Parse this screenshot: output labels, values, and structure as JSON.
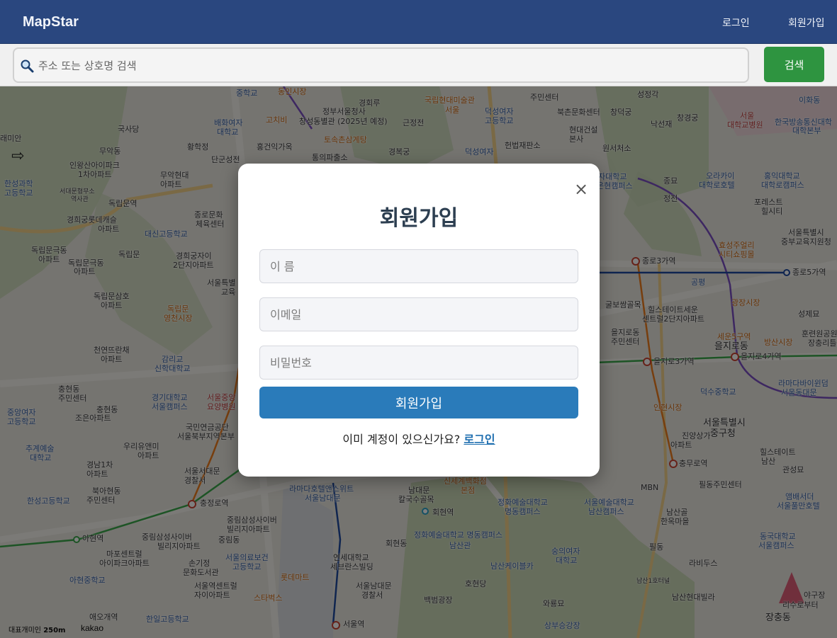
{
  "header": {
    "brand": "MapStar",
    "login_link": "로그인",
    "signup_link": "회원가입"
  },
  "search": {
    "placeholder": "주소 또는 상호명 검색",
    "button_label": "검색",
    "icon": "search-icon"
  },
  "map": {
    "provider": "kakao",
    "scale_label": "250m",
    "scale_prefix": "대표개미인",
    "labels": [
      {
        "text": "중학교",
        "cls": "blue"
      },
      {
        "text": "동인시장",
        "cls": "orange"
      },
      {
        "text": "경회루",
        "cls": ""
      },
      {
        "text": "국립현대미술관",
        "cls": "orange"
      },
      {
        "text": "서울",
        "cls": "orange"
      },
      {
        "text": "주민센터",
        "cls": ""
      },
      {
        "text": "성정각",
        "cls": ""
      },
      {
        "text": "이화동",
        "cls": "blue"
      },
      {
        "text": "국사당",
        "cls": ""
      },
      {
        "text": "배화여자",
        "cls": "blue"
      },
      {
        "text": "대학교",
        "cls": "blue"
      },
      {
        "text": "고치비",
        "cls": "orange"
      },
      {
        "text": "정부서울청사",
        "cls": ""
      },
      {
        "text": "창성동별관 (2025년 예정)",
        "cls": ""
      },
      {
        "text": "근정전",
        "cls": ""
      },
      {
        "text": "덕성여자",
        "cls": "blue"
      },
      {
        "text": "고등학교",
        "cls": "blue"
      },
      {
        "text": "북촌문화센터",
        "cls": ""
      },
      {
        "text": "창덕궁",
        "cls": ""
      },
      {
        "text": "창경궁",
        "cls": ""
      },
      {
        "text": "서울",
        "cls": "red"
      },
      {
        "text": "대학교병원",
        "cls": "red"
      },
      {
        "text": "한국방송통신대학",
        "cls": "blue"
      },
      {
        "text": "대학본부",
        "cls": "blue"
      },
      {
        "text": "낙선재",
        "cls": ""
      },
      {
        "text": "현대건설",
        "cls": ""
      },
      {
        "text": "본사",
        "cls": ""
      },
      {
        "text": "래미안",
        "cls": ""
      },
      {
        "text": "무악동",
        "cls": ""
      },
      {
        "text": "황학정",
        "cls": ""
      },
      {
        "text": "홍건익가옥",
        "cls": ""
      },
      {
        "text": "토속촌삼계탕",
        "cls": "orange"
      },
      {
        "text": "경복궁",
        "cls": ""
      },
      {
        "text": "헌법재판소",
        "cls": ""
      },
      {
        "text": "원서처소",
        "cls": ""
      },
      {
        "text": "통의파출소",
        "cls": ""
      },
      {
        "text": "덕성여자",
        "cls": "blue"
      },
      {
        "text": "인왕산아이파크",
        "cls": ""
      },
      {
        "text": "1차아파트",
        "cls": ""
      },
      {
        "text": "한성과학",
        "cls": "blue"
      },
      {
        "text": "고등학교",
        "cls": "blue"
      },
      {
        "text": "무악현대",
        "cls": ""
      },
      {
        "text": "아파트",
        "cls": ""
      },
      {
        "text": "단군성전",
        "cls": ""
      },
      {
        "text": "서대문형무소",
        "cls": ""
      },
      {
        "text": "역사관",
        "cls": ""
      },
      {
        "text": "독립문역",
        "cls": ""
      },
      {
        "text": "경희궁롯데캐슬",
        "cls": ""
      },
      {
        "text": "아파트",
        "cls": ""
      },
      {
        "text": "종로문화",
        "cls": ""
      },
      {
        "text": "체육센터",
        "cls": ""
      },
      {
        "text": "대신고등학교",
        "cls": "blue"
      },
      {
        "text": "독립문극동",
        "cls": ""
      },
      {
        "text": "아파트",
        "cls": ""
      },
      {
        "text": "독립문극동",
        "cls": ""
      },
      {
        "text": "아파트",
        "cls": ""
      },
      {
        "text": "독립문",
        "cls": ""
      },
      {
        "text": "경희궁자이",
        "cls": ""
      },
      {
        "text": "2단지아파트",
        "cls": ""
      },
      {
        "text": "서울특별",
        "cls": ""
      },
      {
        "text": "교육",
        "cls": ""
      },
      {
        "text": "독립문삼호",
        "cls": ""
      },
      {
        "text": "아파트",
        "cls": ""
      },
      {
        "text": "독립문",
        "cls": "orange"
      },
      {
        "text": "영천시장",
        "cls": "orange"
      },
      {
        "text": "천연뜨란채",
        "cls": ""
      },
      {
        "text": "아파트",
        "cls": ""
      },
      {
        "text": "감리교",
        "cls": "blue"
      },
      {
        "text": "신학대학교",
        "cls": "blue"
      },
      {
        "text": "충현동",
        "cls": ""
      },
      {
        "text": "주민센터",
        "cls": ""
      },
      {
        "text": "중앙여자",
        "cls": "blue"
      },
      {
        "text": "고등학교",
        "cls": "blue"
      },
      {
        "text": "충현동",
        "cls": ""
      },
      {
        "text": "조은아파트",
        "cls": ""
      },
      {
        "text": "경기대학교",
        "cls": "blue"
      },
      {
        "text": "서울캠퍼스",
        "cls": "blue"
      },
      {
        "text": "서울중앙",
        "cls": "red"
      },
      {
        "text": "요양병원",
        "cls": "red"
      },
      {
        "text": "국민연금공단",
        "cls": ""
      },
      {
        "text": "서울북부지역본부",
        "cls": ""
      },
      {
        "text": "추계예술",
        "cls": "blue"
      },
      {
        "text": "대학교",
        "cls": "blue"
      },
      {
        "text": "우리유앤미",
        "cls": ""
      },
      {
        "text": "아파트",
        "cls": ""
      },
      {
        "text": "경남1차",
        "cls": ""
      },
      {
        "text": "아파트",
        "cls": ""
      },
      {
        "text": "서울서대문",
        "cls": ""
      },
      {
        "text": "경찰서",
        "cls": ""
      },
      {
        "text": "북아현동",
        "cls": ""
      },
      {
        "text": "주민센터",
        "cls": ""
      },
      {
        "text": "한성고등학교",
        "cls": "blue"
      },
      {
        "text": "충정로역",
        "cls": ""
      },
      {
        "text": "라마다호텔앤스위트",
        "cls": "blue"
      },
      {
        "text": "서울남대문",
        "cls": "blue"
      },
      {
        "text": "중림삼성사이버",
        "cls": ""
      },
      {
        "text": "빌리지아파트",
        "cls": ""
      },
      {
        "text": "중림삼성사이버",
        "cls": ""
      },
      {
        "text": "빌리지아파트",
        "cls": ""
      },
      {
        "text": "중림동",
        "cls": ""
      },
      {
        "text": "아현역",
        "cls": ""
      },
      {
        "text": "마포센트럴",
        "cls": ""
      },
      {
        "text": "아이파크아파트",
        "cls": ""
      },
      {
        "text": "손기정",
        "cls": ""
      },
      {
        "text": "문화도서관",
        "cls": ""
      },
      {
        "text": "서울의료보건",
        "cls": "blue"
      },
      {
        "text": "고등학교",
        "cls": "blue"
      },
      {
        "text": "아현중학교",
        "cls": "blue"
      },
      {
        "text": "서울역센트럴",
        "cls": ""
      },
      {
        "text": "자이아파트",
        "cls": ""
      },
      {
        "text": "스타벅스",
        "cls": "orange"
      },
      {
        "text": "애오개역",
        "cls": ""
      },
      {
        "text": "한일고등학교",
        "cls": "blue"
      },
      {
        "text": "서울역",
        "cls": ""
      },
      {
        "text": "롯데마트",
        "cls": "orange"
      },
      {
        "text": "연세대학교",
        "cls": ""
      },
      {
        "text": "세브란스빌딩",
        "cls": ""
      },
      {
        "text": "서울남대문",
        "cls": ""
      },
      {
        "text": "경찰서",
        "cls": ""
      },
      {
        "text": "남대문",
        "cls": ""
      },
      {
        "text": "칼국수골목",
        "cls": ""
      },
      {
        "text": "회현역",
        "cls": ""
      },
      {
        "text": "회현동",
        "cls": ""
      },
      {
        "text": "신세계백화점",
        "cls": "orange"
      },
      {
        "text": "본점",
        "cls": "orange"
      },
      {
        "text": "정화예술대학교",
        "cls": "blue"
      },
      {
        "text": "명동캠퍼스",
        "cls": "blue"
      },
      {
        "text": "정화예술대학교 명동캠퍼스",
        "cls": "blue"
      },
      {
        "text": "남산관",
        "cls": "blue"
      },
      {
        "text": "서울예술대학교",
        "cls": "blue"
      },
      {
        "text": "남산캠퍼스",
        "cls": "blue"
      },
      {
        "text": "숭의여자",
        "cls": "blue"
      },
      {
        "text": "대학교",
        "cls": "blue"
      },
      {
        "text": "남산케이블카",
        "cls": "blue"
      },
      {
        "text": "호현당",
        "cls": ""
      },
      {
        "text": "백범광장",
        "cls": ""
      },
      {
        "text": "와룡묘",
        "cls": ""
      },
      {
        "text": "상부승강장",
        "cls": "blue"
      },
      {
        "text": "남산골",
        "cls": ""
      },
      {
        "text": "한옥마을",
        "cls": ""
      },
      {
        "text": "필동",
        "cls": ""
      },
      {
        "text": "라비두스",
        "cls": ""
      },
      {
        "text": "남산1호터널",
        "cls": ""
      },
      {
        "text": "남산현대빌라",
        "cls": ""
      },
      {
        "text": "동국대학교",
        "cls": "blue"
      },
      {
        "text": "서울캠퍼스",
        "cls": "blue"
      },
      {
        "text": "장충동",
        "cls": ""
      },
      {
        "text": "종로3가역",
        "cls": ""
      },
      {
        "text": "종로5가역",
        "cls": ""
      },
      {
        "text": "효성주얼리",
        "cls": "orange"
      },
      {
        "text": "시티쇼핑몰",
        "cls": "orange"
      },
      {
        "text": "광장시장",
        "cls": "orange"
      },
      {
        "text": "공평",
        "cls": "blue"
      },
      {
        "text": "굴보쌈골목",
        "cls": ""
      },
      {
        "text": "힐스테이트세운",
        "cls": ""
      },
      {
        "text": "센트럴2단지아파트",
        "cls": ""
      },
      {
        "text": "을지로동",
        "cls": ""
      },
      {
        "text": "주민센터",
        "cls": ""
      },
      {
        "text": "을지로3가역",
        "cls": ""
      },
      {
        "text": "을지로4가역",
        "cls": ""
      },
      {
        "text": "세운5구역",
        "cls": "orange"
      },
      {
        "text": "을지로동",
        "cls": "big"
      },
      {
        "text": "방산시장",
        "cls": "orange"
      },
      {
        "text": "덕수중학교",
        "cls": "blue"
      },
      {
        "text": "라마다바이윈덤",
        "cls": "blue"
      },
      {
        "text": "서울동대문",
        "cls": "blue"
      },
      {
        "text": "인현시장",
        "cls": "orange"
      },
      {
        "text": "서울특별시",
        "cls": "big"
      },
      {
        "text": "중구청",
        "cls": "big"
      },
      {
        "text": "진양상가",
        "cls": ""
      },
      {
        "text": "아파트",
        "cls": ""
      },
      {
        "text": "충무로역",
        "cls": ""
      },
      {
        "text": "힐스테이트",
        "cls": ""
      },
      {
        "text": "남산",
        "cls": ""
      },
      {
        "text": "관성묘",
        "cls": ""
      },
      {
        "text": "필동주민센터",
        "cls": ""
      },
      {
        "text": "MBN",
        "cls": ""
      },
      {
        "text": "앰배서더",
        "cls": "blue"
      },
      {
        "text": "서울풀만호텔",
        "cls": "blue"
      },
      {
        "text": "오라카이",
        "cls": "blue"
      },
      {
        "text": "대학로호텔",
        "cls": "blue"
      },
      {
        "text": "홍익대학교",
        "cls": "blue"
      },
      {
        "text": "대학로캠퍼스",
        "cls": "blue"
      },
      {
        "text": "포레스트",
        "cls": ""
      },
      {
        "text": "힐시티",
        "cls": ""
      },
      {
        "text": "서울특별시",
        "cls": ""
      },
      {
        "text": "중부교육지원청",
        "cls": ""
      },
      {
        "text": "종묘",
        "cls": ""
      },
      {
        "text": "정전",
        "cls": ""
      },
      {
        "text": "자대학교",
        "cls": "blue"
      },
      {
        "text": "은현캠퍼스",
        "cls": "blue"
      },
      {
        "text": "성제묘",
        "cls": ""
      },
      {
        "text": "훈련원공원",
        "cls": ""
      },
      {
        "text": "장충리틀",
        "cls": ""
      },
      {
        "text": "야구장",
        "cls": ""
      },
      {
        "text": "리수로부터",
        "cls": ""
      },
      {
        "text": "중부수도사업소",
        "cls": ""
      }
    ]
  },
  "modal": {
    "title": "회원가입",
    "close_label": "×",
    "name_placeholder": "이 름",
    "email_placeholder": "이메일",
    "password_placeholder": "비밀번호",
    "submit_label": "회원가입",
    "switch_text": "이미 계정이 있으신가요?",
    "switch_link": "로그인"
  }
}
